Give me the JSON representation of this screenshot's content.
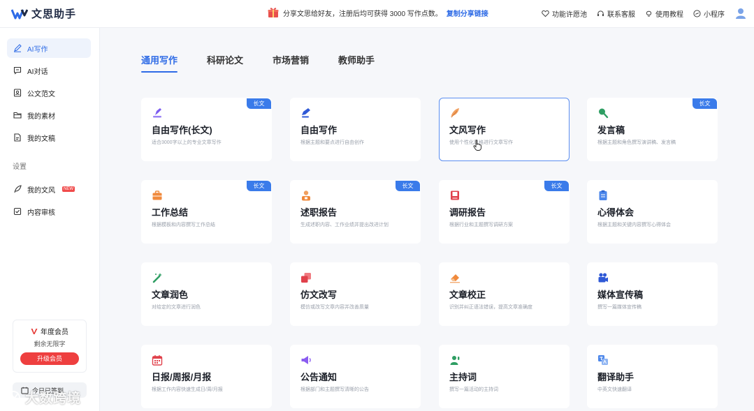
{
  "header": {
    "logo_text": "文思助手",
    "promo_text": "分享文思给好友，注册后均可获得 3000 写作点数。",
    "promo_link": "复制分享链接",
    "nav": [
      {
        "label": "功能许愿池",
        "icon": "heart-icon"
      },
      {
        "label": "联系客服",
        "icon": "headset-icon"
      },
      {
        "label": "使用教程",
        "icon": "bulb-icon"
      },
      {
        "label": "小程序",
        "icon": "miniprogram-icon"
      }
    ]
  },
  "sidebar": {
    "items": [
      {
        "label": "AI写作",
        "icon": "pen-icon",
        "active": true
      },
      {
        "label": "AI对话",
        "icon": "chat-icon"
      },
      {
        "label": "公文范文",
        "icon": "document-badge-icon"
      },
      {
        "label": "我的素材",
        "icon": "folder-icon"
      },
      {
        "label": "我的文稿",
        "icon": "file-icon"
      }
    ],
    "settings_label": "设置",
    "settings_items": [
      {
        "label": "我的文风",
        "icon": "feather-icon",
        "badge": "NEW"
      },
      {
        "label": "内容审核",
        "icon": "check-square-icon"
      }
    ],
    "vip": {
      "title": "年度会员",
      "subtitle": "剩余无限字",
      "button": "升级会员"
    },
    "signin": "今日已签到"
  },
  "watermark": "大数跨境",
  "tabs": [
    {
      "label": "通用写作",
      "active": true
    },
    {
      "label": "科研论文"
    },
    {
      "label": "市场营销"
    },
    {
      "label": "教师助手"
    }
  ],
  "cards": [
    {
      "title": "自由写作(长文)",
      "desc": "适合3000字以上的专业文章写作",
      "tag": "长文",
      "icon": "pen-purple-icon"
    },
    {
      "title": "自由写作",
      "desc": "根据主题和要点进行自由创作",
      "tag": "",
      "icon": "pen-blue-icon"
    },
    {
      "title": "文风写作",
      "desc": "使用个性化风格进行文章写作",
      "tag": "",
      "icon": "feather-orange-icon",
      "hover": true
    },
    {
      "title": "发言稿",
      "desc": "根据主题和角色撰写演讲稿、发言稿",
      "tag": "长文",
      "icon": "microphone-green-icon"
    },
    {
      "title": "工作总结",
      "desc": "根据模板和内容撰写工作总结",
      "tag": "长文",
      "icon": "briefcase-orange-icon"
    },
    {
      "title": "述职报告",
      "desc": "生成述职内容、工作业绩并提出改进计划",
      "tag": "长文",
      "icon": "person-orange-icon"
    },
    {
      "title": "调研报告",
      "desc": "根据行业和主题撰写调研方案",
      "tag": "长文",
      "icon": "book-red-icon"
    },
    {
      "title": "心得体会",
      "desc": "根据主题和关键内容撰写心得体会",
      "tag": "",
      "icon": "clipboard-blue-icon"
    },
    {
      "title": "文章润色",
      "desc": "对给定的文章进行润色",
      "tag": "",
      "icon": "magic-wand-icon"
    },
    {
      "title": "仿文改写",
      "desc": "模仿或改写文章内容并改善质量",
      "tag": "",
      "icon": "copy-red-icon"
    },
    {
      "title": "文章校正",
      "desc": "识别并纠正语法错误，提高文章准确度",
      "tag": "",
      "icon": "eraser-orange-icon"
    },
    {
      "title": "媒体宣传稿",
      "desc": "撰写一篇媒体宣传稿",
      "tag": "",
      "icon": "camera-blue-icon"
    },
    {
      "title": "日报/周报/月报",
      "desc": "根据工作内容快速生成日/周/月报",
      "tag": "",
      "icon": "calendar-red-icon"
    },
    {
      "title": "公告通知",
      "desc": "根据部门和主题撰写清晰的公告",
      "tag": "",
      "icon": "megaphone-purple-icon"
    },
    {
      "title": "主持词",
      "desc": "撰写一篇活动的主持词",
      "tag": "",
      "icon": "host-green-icon"
    },
    {
      "title": "翻译助手",
      "desc": "中英文快速翻译",
      "tag": "",
      "icon": "translate-blue-icon"
    }
  ]
}
